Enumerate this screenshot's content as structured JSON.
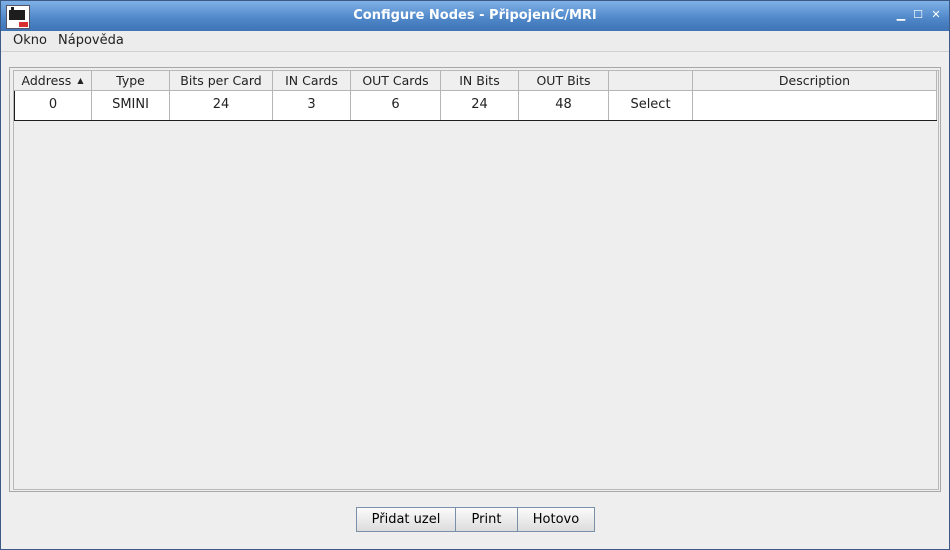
{
  "window": {
    "title": "Configure Nodes - PřipojeníC/MRI"
  },
  "menu": {
    "items": [
      "Okno",
      "Nápověda"
    ]
  },
  "table": {
    "columns": [
      "Address",
      "Type",
      "Bits per Card",
      "IN Cards",
      "OUT Cards",
      "IN Bits",
      "OUT Bits",
      "",
      "Description"
    ],
    "sort_column": "Address",
    "sort_direction": "ascending",
    "rows": [
      {
        "address": "0",
        "type": "SMINI",
        "bits_per_card": "24",
        "in_cards": "3",
        "out_cards": "6",
        "in_bits": "24",
        "out_bits": "48",
        "action": "Select",
        "description": ""
      }
    ]
  },
  "buttons": {
    "add_node": "Přidat uzel",
    "print": "Print",
    "done": "Hotovo"
  },
  "icons": {
    "app": "jmri-locomotive-icon",
    "sort": "sort-ascending-icon"
  },
  "colors": {
    "titlebar": "#4e86c8",
    "background": "#eeeeee"
  }
}
